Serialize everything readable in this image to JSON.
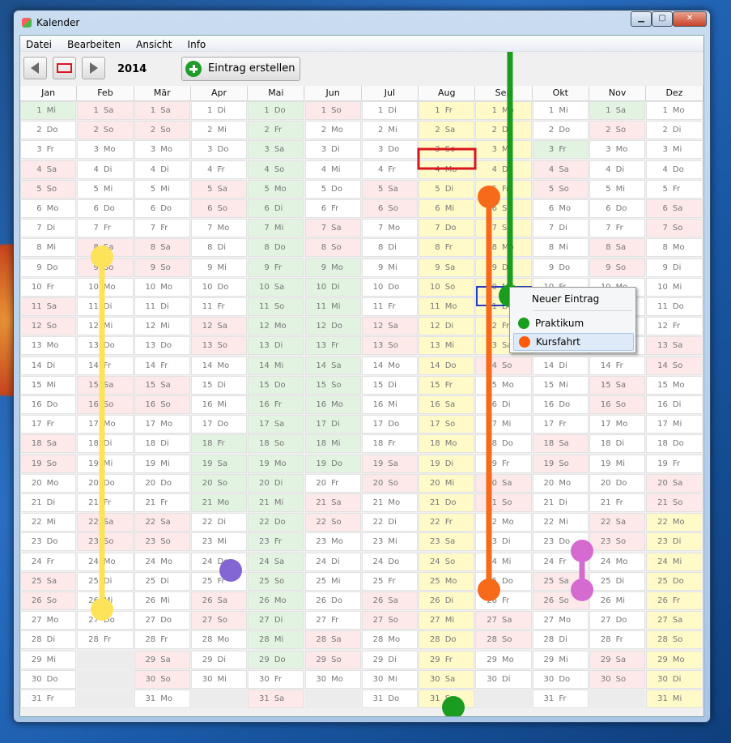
{
  "window": {
    "title": "Kalender",
    "buttons": {
      "minimize": "▁",
      "maximize": "▢",
      "close": "✕"
    }
  },
  "menu": [
    "Datei",
    "Bearbeiten",
    "Ansicht",
    "Info"
  ],
  "toolbar": {
    "year": "2014",
    "create_label": "Eintrag erstellen",
    "prev_icon": "arrow-left-icon",
    "today_icon": "rectangle-icon",
    "next_icon": "arrow-right-icon"
  },
  "months": [
    "Jan",
    "Feb",
    "Mär",
    "Apr",
    "Mai",
    "Jun",
    "Jul",
    "Aug",
    "Sep",
    "Okt",
    "Nov",
    "Dez"
  ],
  "calendar": {
    "year": 2014,
    "weekday_labels": [
      "Mo",
      "Di",
      "Mi",
      "Do",
      "Fr",
      "Sa",
      "So"
    ],
    "first_weekday_of_year": "Mi"
  },
  "context_menu": {
    "header": "Neuer Eintrag",
    "items": [
      {
        "label": "Praktikum",
        "color": "#1a9c1f"
      },
      {
        "label": "Kursfahrt",
        "color": "#ff5a0a"
      }
    ]
  },
  "colors": {
    "weekend": "#fde9e9",
    "holiday": "#e2f3e2",
    "school_holiday": "#fffac8",
    "entry_green": "#1a9c1f",
    "entry_orange": "#f66a1a",
    "entry_yellow": "#fde35a",
    "entry_purple": "#8366d3",
    "entry_pink": "#d56bd0",
    "selection": "#d9171e"
  }
}
